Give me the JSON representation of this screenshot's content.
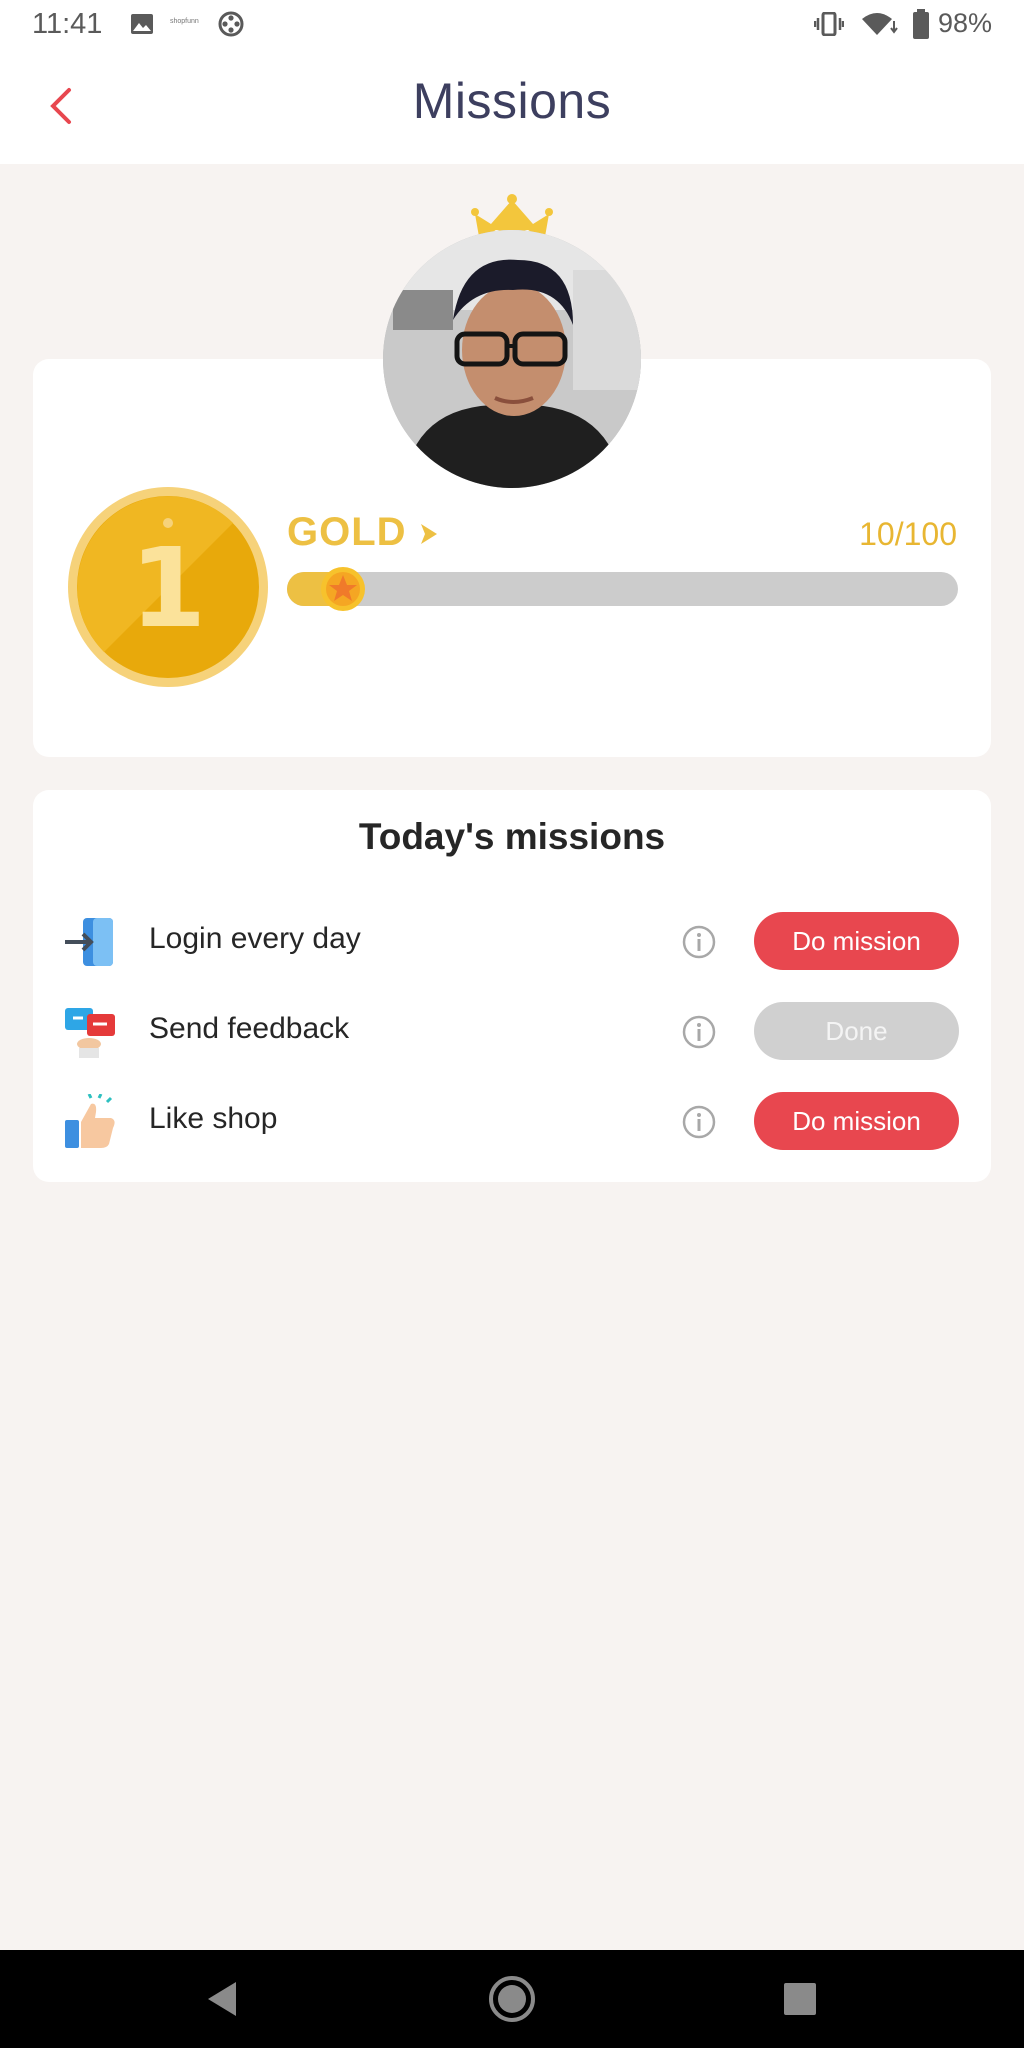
{
  "status_bar": {
    "time": "11:41",
    "notif_app_label": "shopfunn",
    "battery": "98%",
    "icons": [
      "image-icon",
      "app-logo-icon",
      "film-reel-icon",
      "vibrate-icon",
      "wifi-icon",
      "battery-icon"
    ]
  },
  "header": {
    "title": "Missions",
    "back_icon": "chevron-left-icon"
  },
  "level": {
    "crown_icon": "crown-icon",
    "avatar_alt": "user-avatar",
    "coin_number": "1",
    "rank": "GOLD",
    "progress_text": "10/100",
    "progress_fraction": 0.1,
    "colors": {
      "gold": "#edc043",
      "track": "#cccccc"
    }
  },
  "missions": {
    "title": "Today's missions",
    "items": [
      {
        "icon": "login-icon",
        "label": "Login every day",
        "button": "Do mission",
        "state": "active"
      },
      {
        "icon": "feedback-icon",
        "label": "Send feedback",
        "button": "Done",
        "state": "done"
      },
      {
        "icon": "like-icon",
        "label": "Like shop",
        "button": "Do mission",
        "state": "active"
      }
    ],
    "colors": {
      "active": "#e8474f",
      "done": "#d0d0d0"
    }
  },
  "nav": {
    "icons": [
      "back-triangle-icon",
      "home-circle-icon",
      "recents-square-icon"
    ]
  }
}
